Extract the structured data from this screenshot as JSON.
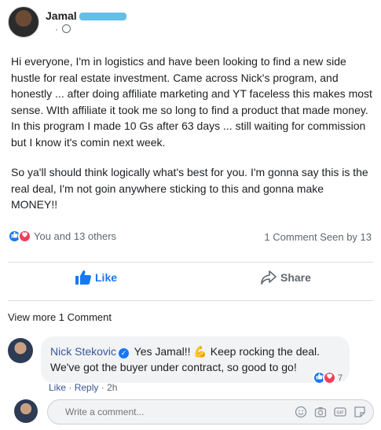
{
  "post": {
    "author": "Jamal",
    "meta_dot": "·",
    "body": [
      "Hi everyone, I'm in logistics and have been looking to find a new side hustle for real estate investment. Came across Nick's program, and honestly ... after doing affiliate marketing and YT faceless this makes most sense. WIth affiliate it took me so long to find a product that made money. In this program I made 10 Gs after 63 days ... still waiting for commission but I know it's comin next week.",
      "So ya'll should think logically what's best for you. I'm gonna say this is the real deal, I'm not goin anywhere sticking to this and gonna make MONEY!!"
    ],
    "reactions_text": "You and 13 others",
    "stats_text": "1 Comment Seen by 13"
  },
  "actions": {
    "like_label": "Like",
    "share_label": "Share"
  },
  "view_more": "View more 1 Comment",
  "comment": {
    "author": "Nick Stekovic",
    "text": "Yes Jamal!! 💪 Keep rocking the deal. We've got the buyer under contract, so good to go!",
    "reaction_count": "7",
    "like_link": "Like",
    "reply_link": "Reply",
    "time": "2h",
    "sep": "·"
  },
  "write_comment": {
    "placeholder": "Write a comment..."
  },
  "colors": {
    "accent": "#1877f2",
    "love": "#f33e58",
    "link": "#385898"
  },
  "icons": [
    "globe-icon",
    "like-reaction-icon",
    "love-reaction-icon",
    "thumbs-up-icon",
    "share-arrow-icon",
    "verified-badge-icon",
    "emoji-icon",
    "camera-icon",
    "gif-icon",
    "sticker-icon"
  ]
}
